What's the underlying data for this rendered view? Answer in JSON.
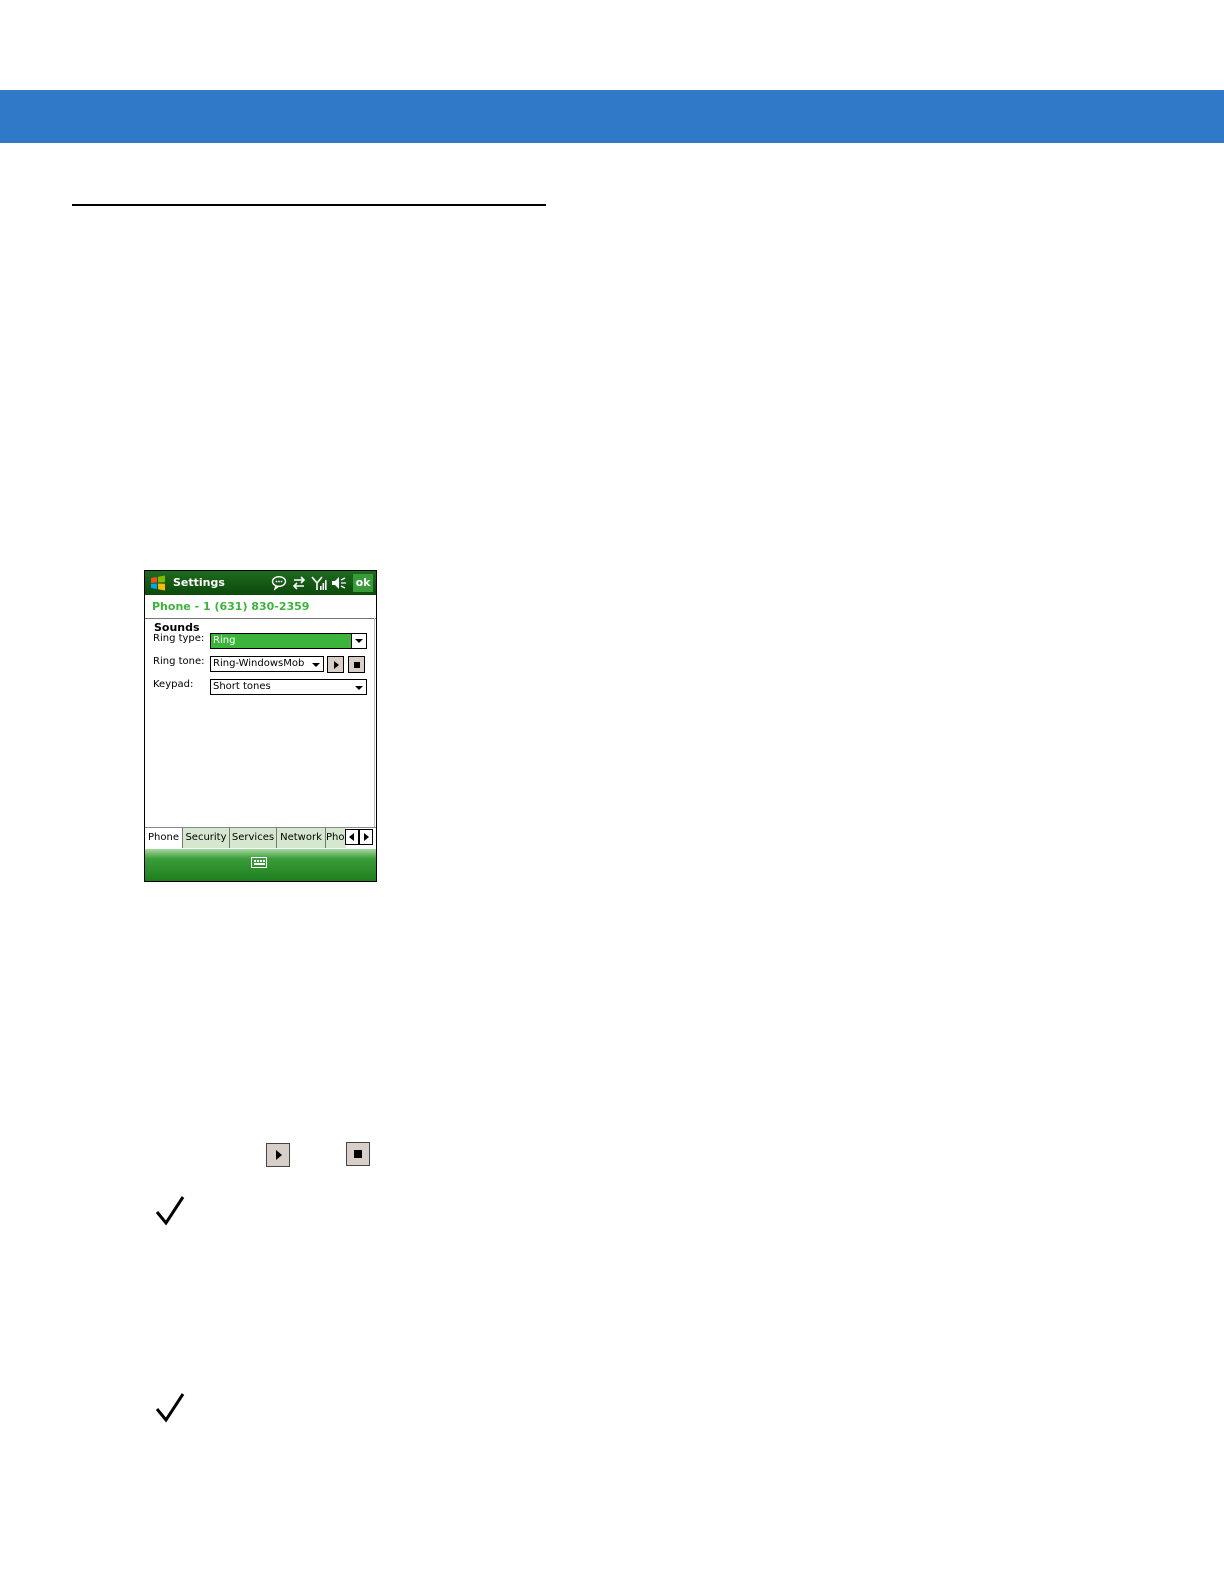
{
  "device": {
    "title": "Settings",
    "ok_label": "ok",
    "subheader": "Phone - 1 (631) 830-2359",
    "section": "Sounds",
    "fields": [
      {
        "label": "Ring type:",
        "value": "Ring"
      },
      {
        "label": "Ring tone:",
        "value": "Ring-WindowsMob"
      },
      {
        "label": "Keypad:",
        "value": "Short tones"
      }
    ],
    "tabs": [
      "Phone",
      "Security",
      "Services",
      "Network",
      "Pho"
    ],
    "icons": {
      "start": "windows-start-icon",
      "status": [
        "message-bubble-icon",
        "sync-arrows-icon",
        "signal-icon",
        "speaker-muted-icon"
      ],
      "keyboard": "keyboard-icon"
    }
  },
  "colors": {
    "banner": "#3078c8",
    "title_bar": "#0b4a0b",
    "accent_green": "#3cb43c",
    "button_gray": "#d8d0c8"
  }
}
